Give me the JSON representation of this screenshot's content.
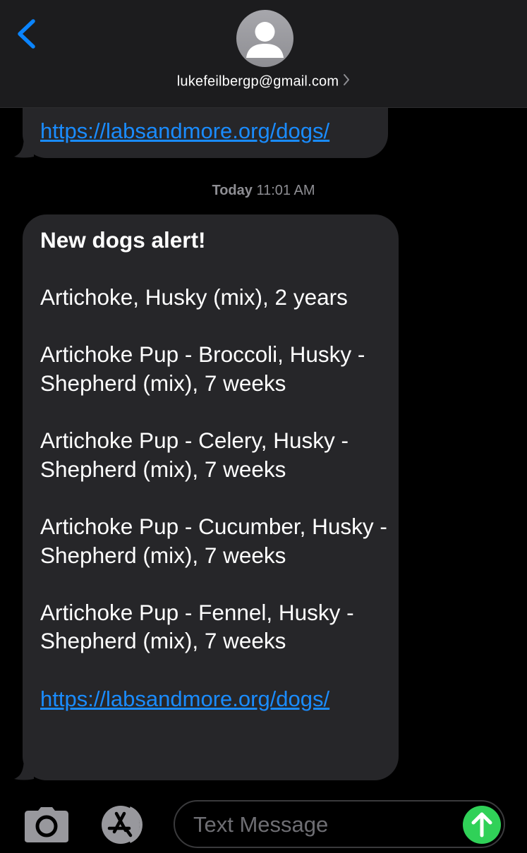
{
  "header": {
    "contact": "lukefeilbergp@gmail.com"
  },
  "messages": {
    "previous_link": "https://labsandmore.org/dogs/",
    "timestamp_day": "Today",
    "timestamp_time": "11:01 AM",
    "main": {
      "title": "New dogs alert!",
      "lines": [
        "Artichoke, Husky (mix), 2 years",
        "Artichoke Pup - Broccoli, Husky - Shepherd (mix), 7 weeks",
        "Artichoke Pup - Celery, Husky - Shepherd (mix), 7 weeks",
        "Artichoke Pup - Cucumber, Husky - Shepherd (mix), 7 weeks",
        "Artichoke Pup - Fennel, Husky - Shepherd (mix), 7 weeks"
      ],
      "link": "https://labsandmore.org/dogs/"
    }
  },
  "composer": {
    "placeholder": "Text Message"
  },
  "colors": {
    "background": "#000000",
    "bubble": "#262629",
    "link": "#1a8cff",
    "send": "#30d158",
    "back_chevron": "#0a84ff"
  },
  "icons": [
    "back-chevron-icon",
    "avatar-icon",
    "chevron-right-icon",
    "camera-icon",
    "app-store-icon",
    "send-arrow-icon"
  ]
}
